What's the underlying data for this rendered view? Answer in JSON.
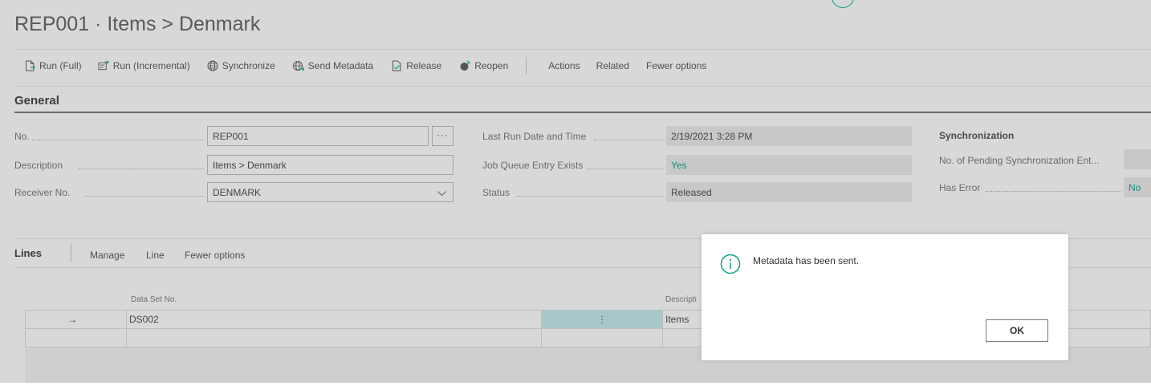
{
  "page": {
    "title": "REP001 · Items > Denmark"
  },
  "actions": {
    "items": [
      {
        "label": "Run (Full)",
        "icon": "document-run-icon"
      },
      {
        "label": "Run (Incremental)",
        "icon": "incremental-run-icon"
      },
      {
        "label": "Synchronize",
        "icon": "globe-icon"
      },
      {
        "label": "Send Metadata",
        "icon": "globe-send-icon"
      },
      {
        "label": "Release",
        "icon": "document-check-icon"
      },
      {
        "label": "Reopen",
        "icon": "reopen-icon"
      }
    ],
    "menus": [
      "Actions",
      "Related",
      "Fewer options"
    ]
  },
  "general": {
    "title": "General",
    "no_label": "No.",
    "no_value": "REP001",
    "description_label": "Description",
    "description_value": "Items > Denmark",
    "receiver_label": "Receiver No.",
    "receiver_value": "DENMARK",
    "last_run_label": "Last Run Date and Time",
    "last_run_value": "2/19/2021 3:28 PM",
    "job_queue_label": "Job Queue Entry Exists",
    "job_queue_value": "Yes",
    "status_label": "Status",
    "status_value": "Released",
    "sync_title": "Synchronization",
    "pending_label": "No. of Pending Synchronization Ent...",
    "has_error_label": "Has Error",
    "has_error_value": "No"
  },
  "lines": {
    "title": "Lines",
    "menus": [
      "Manage",
      "Line",
      "Fewer options"
    ],
    "col_dataset": "Data Set No.",
    "col_description": "Descripti",
    "rows": [
      {
        "arrow": "→",
        "dataset": "DS002",
        "description": "Items"
      }
    ]
  },
  "dialog": {
    "message": "Metadata has been sent.",
    "ok_label": "OK",
    "icon": "info-icon"
  },
  "colors": {
    "accent": "#0f9d85",
    "overlay_bg": "#d8d8d8"
  }
}
